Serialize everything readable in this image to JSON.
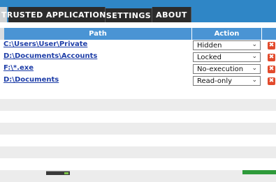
{
  "tabs": {
    "trusted": "TRUSTED APPLICATIONS",
    "settings": "SETTINGS",
    "about": "ABOUT"
  },
  "table": {
    "headers": {
      "path": "Path",
      "action": "Action"
    },
    "rows": [
      {
        "path": "C:\\Users\\User\\Private",
        "action": "Hidden"
      },
      {
        "path": "D:\\Documents\\Accounts",
        "action": "Locked"
      },
      {
        "path": "F:\\*.exe",
        "action": "No-execution"
      },
      {
        "path": "D:\\Documents",
        "action": "Read-only"
      }
    ]
  },
  "icons": {
    "delete": "close-icon",
    "dropdown": "chevron-down-icon"
  },
  "colors": {
    "tab_bar": "#2f86c6",
    "header": "#4a94d4",
    "delete": "#e24a2c",
    "link": "#1e3ea8"
  }
}
